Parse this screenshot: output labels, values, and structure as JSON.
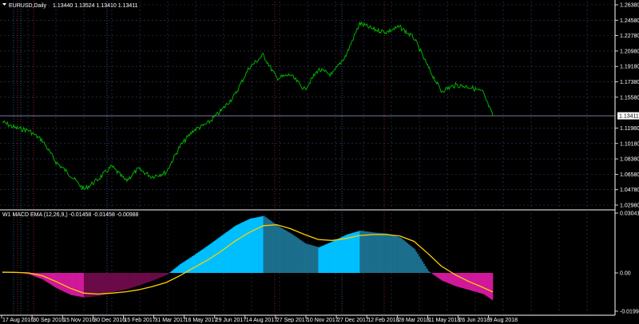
{
  "colors": {
    "background": "#000000",
    "grid": "#3a3a70",
    "text": "#ffffff",
    "price_line": "#00b000",
    "current_price_line": "#7a7aa0",
    "price_label_bg": "#ffffff",
    "price_label_text": "#000000",
    "histogram_light_blue": "#00bfff",
    "histogram_dark_teal": "#1b6f8c",
    "histogram_magenta": "#d0189a",
    "histogram_dark_magenta": "#6a0a48",
    "signal_line": "#ffd000",
    "separator": "#808080",
    "vline_blue": "#3a7ecf",
    "vline_red": "#c03030"
  },
  "top_panel": {
    "header_icon": "dropdown-triangle-icon",
    "symbol": "EURUSD,Daily",
    "ohlc": "1.13440 1.13524 1.13410 1.13411"
  },
  "bottom_panel": {
    "header": "W1 MACD EMA (12,26,9,) -0.01458 -0.01458 -0.00988"
  },
  "chart_data": [
    {
      "type": "line",
      "title": "EURUSD,Daily",
      "y_ticks": [
        "1.26380",
        "1.24580",
        "1.22780",
        "1.20980",
        "1.19180",
        "1.17380",
        "1.15580",
        "1.13411",
        "1.11980",
        "1.10180",
        "1.08380",
        "1.06580",
        "1.04780",
        "1.02980"
      ],
      "ylim": [
        1.0298,
        1.2638
      ],
      "current_price": 1.13411,
      "x": [
        "2016-08-17",
        "2016-09-05",
        "2016-09-25",
        "2016-10-15",
        "2016-11-04",
        "2016-11-25",
        "2016-12-15",
        "2017-01-05",
        "2017-01-25",
        "2017-02-15",
        "2017-03-05",
        "2017-03-25",
        "2017-04-15",
        "2017-05-05",
        "2017-05-25",
        "2017-06-15",
        "2017-07-05",
        "2017-07-25",
        "2017-08-15",
        "2017-09-05",
        "2017-09-25",
        "2017-10-15",
        "2017-11-05",
        "2017-11-25",
        "2017-12-15",
        "2018-01-05",
        "2018-01-25",
        "2018-02-15",
        "2018-03-05",
        "2018-03-25",
        "2018-04-15",
        "2018-05-05",
        "2018-05-25",
        "2018-06-15",
        "2018-07-05",
        "2018-07-25",
        "2018-08-09"
      ],
      "values": [
        1.127,
        1.12,
        1.117,
        1.105,
        1.08,
        1.065,
        1.048,
        1.06,
        1.075,
        1.058,
        1.072,
        1.063,
        1.068,
        1.098,
        1.117,
        1.125,
        1.14,
        1.158,
        1.19,
        1.205,
        1.178,
        1.182,
        1.165,
        1.188,
        1.182,
        1.205,
        1.242,
        1.235,
        1.232,
        1.238,
        1.225,
        1.192,
        1.163,
        1.17,
        1.168,
        1.162,
        1.134
      ]
    },
    {
      "type": "bar",
      "title": "W1 MACD EMA (12,26,9,)",
      "y_ticks": [
        "0.03041",
        "0.00",
        "-0.01996"
      ],
      "ylim": [
        -0.01996,
        0.03041
      ],
      "x_ticks": [
        "17 Aug 2016",
        "30 Sep 2016",
        "15 Nov 2016",
        "30 Dec 2016",
        "15 Feb 2017",
        "31 Mar 2017",
        "16 May 2017",
        "29 Jun 2017",
        "14 Aug 2017",
        "27 Sep 2017",
        "10 Nov 2017",
        "27 Dec 2017",
        "12 Feb 2018",
        "28 Mar 2018",
        "11 May 2018",
        "26 Jun 2018",
        "9 Aug 2018"
      ],
      "x": [
        "2016-08-17",
        "2016-09-05",
        "2016-09-25",
        "2016-10-15",
        "2016-11-04",
        "2016-11-25",
        "2016-12-15",
        "2017-01-05",
        "2017-01-25",
        "2017-02-15",
        "2017-03-05",
        "2017-03-25",
        "2017-04-15",
        "2017-05-05",
        "2017-05-25",
        "2017-06-15",
        "2017-07-05",
        "2017-07-25",
        "2017-08-15",
        "2017-09-05",
        "2017-09-25",
        "2017-10-15",
        "2017-11-05",
        "2017-11-25",
        "2017-12-15",
        "2018-01-05",
        "2018-01-25",
        "2018-02-15",
        "2018-03-05",
        "2018-03-25",
        "2018-04-15",
        "2018-05-05",
        "2018-05-25",
        "2018-06-15",
        "2018-07-05",
        "2018-07-25",
        "2018-08-09"
      ],
      "series": [
        {
          "values": [
            0.0005,
            0.0004,
            -0.0008,
            -0.0035,
            -0.008,
            -0.0115,
            -0.0128,
            -0.012,
            -0.01,
            -0.0085,
            -0.0065,
            -0.004,
            -0.001,
            0.0045,
            0.009,
            0.014,
            0.019,
            0.024,
            0.0275,
            0.029,
            0.024,
            0.02,
            0.015,
            0.013,
            0.016,
            0.0195,
            0.0215,
            0.0205,
            0.02,
            0.018,
            0.012,
            0.001,
            -0.004,
            -0.007,
            -0.009,
            -0.011,
            -0.0146
          ]
        },
        {
          "values": [
            0.0004,
            0.0003,
            0.0,
            -0.0015,
            -0.0045,
            -0.008,
            -0.0105,
            -0.011,
            -0.0105,
            -0.0098,
            -0.0088,
            -0.0072,
            -0.005,
            -0.0015,
            0.0025,
            0.0065,
            0.011,
            0.016,
            0.0205,
            0.024,
            0.0245,
            0.0225,
            0.0195,
            0.017,
            0.0165,
            0.0175,
            0.019,
            0.0195,
            0.0195,
            0.0188,
            0.016,
            0.01,
            0.0035,
            -0.001,
            -0.0045,
            -0.0075,
            -0.0099
          ]
        }
      ]
    }
  ]
}
